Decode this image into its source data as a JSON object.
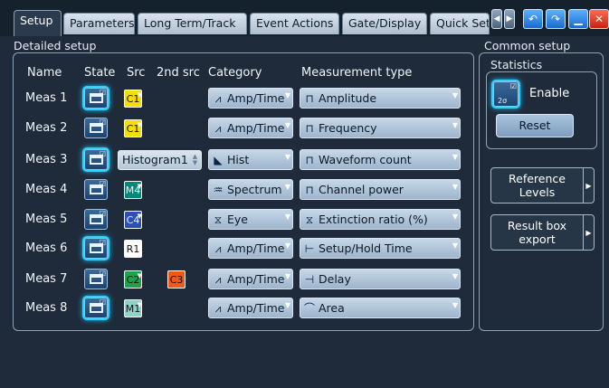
{
  "tabs": [
    "Setup",
    "Parameters",
    "Long Term/Track",
    "Event Actions",
    "Gate/Display",
    "Quick Set"
  ],
  "tab_controls": [
    "scroll-left",
    "scroll-right",
    "undo",
    "redo",
    "minimize",
    "close"
  ],
  "detailed_setup": {
    "title": "Detailed setup",
    "columns": [
      "Name",
      "State",
      "Src",
      "2nd src",
      "Category",
      "Measurement type"
    ],
    "rows": [
      {
        "name": "Meas 1",
        "state_on": true,
        "src": "C1",
        "src_color": "#f4e000",
        "src2": "",
        "src2_color": "",
        "category": "Amp/Time",
        "category_icon": "amp-time-icon",
        "type": "Amplitude",
        "type_icon": "amplitude-icon"
      },
      {
        "name": "Meas 2",
        "state_on": false,
        "src": "C1",
        "src_color": "#f4e000",
        "src2": "",
        "src2_color": "",
        "category": "Amp/Time",
        "category_icon": "amp-time-icon",
        "type": "Frequency",
        "type_icon": "frequency-icon"
      },
      {
        "name": "Meas 3",
        "state_on": true,
        "src": "Histogram1",
        "src_color": "",
        "src2": "",
        "src2_color": "",
        "category": "Hist",
        "category_icon": "hist-icon",
        "type": "Waveform count",
        "type_icon": "waveform-count-icon"
      },
      {
        "name": "Meas 4",
        "state_on": false,
        "src": "M4",
        "src_color": "#00877a",
        "src2": "",
        "src2_color": "",
        "category": "Spectrum",
        "category_icon": "spectrum-icon",
        "type": "Channel power",
        "type_icon": "channel-power-icon"
      },
      {
        "name": "Meas 5",
        "state_on": false,
        "src": "C4",
        "src_color": "#2d4fb8",
        "src2": "",
        "src2_color": "",
        "category": "Eye",
        "category_icon": "eye-icon",
        "type": "Extinction ratio (%)",
        "type_icon": "extinction-ratio-icon"
      },
      {
        "name": "Meas 6",
        "state_on": true,
        "src": "R1",
        "src_color": "#ffffff",
        "src2": "",
        "src2_color": "",
        "category": "Amp/Time",
        "category_icon": "amp-time-icon",
        "type": "Setup/Hold Time",
        "type_icon": "setup-hold-icon"
      },
      {
        "name": "Meas 7",
        "state_on": false,
        "src": "C2",
        "src_color": "#1fa34a",
        "src2": "C3",
        "src2_color": "#f05a14",
        "category": "Amp/Time",
        "category_icon": "amp-time-icon",
        "type": "Delay",
        "type_icon": "delay-icon"
      },
      {
        "name": "Meas 8",
        "state_on": true,
        "src": "M1",
        "src_color": "#8fd3c8",
        "src2": "",
        "src2_color": "",
        "category": "Amp/Time",
        "category_icon": "amp-time-icon",
        "type": "Area",
        "type_icon": "area-icon"
      }
    ]
  },
  "common_setup": {
    "title": "Common setup",
    "statistics_label": "Statistics",
    "enable_label": "Enable",
    "enable_icon_text": "2σ",
    "reset_label": "Reset",
    "reference_levels_line1": "Reference",
    "reference_levels_line2": "Levels",
    "result_box_line1": "Result box",
    "result_box_line2": "export"
  }
}
